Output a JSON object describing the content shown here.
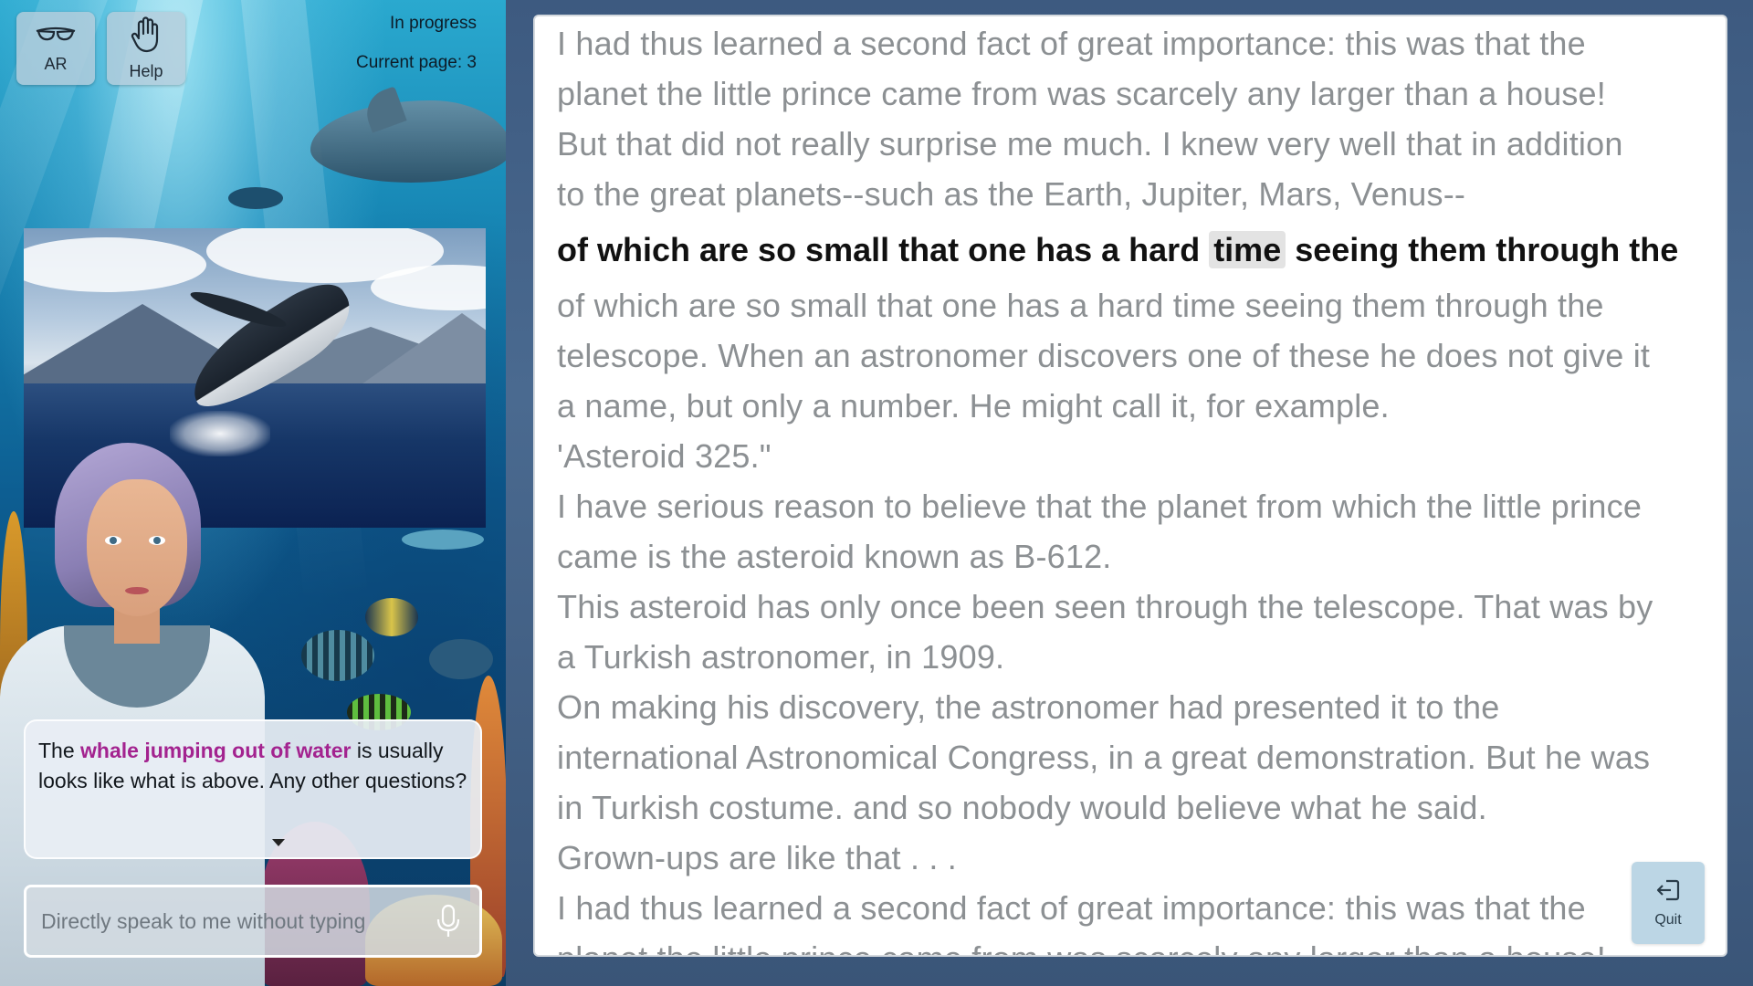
{
  "status": {
    "state": "In progress",
    "current_page": "Current page: 3"
  },
  "toolbar": {
    "ar_label": "AR",
    "help_label": "Help",
    "quit_label": "Quit"
  },
  "chat": {
    "message_prefix": "The ",
    "message_highlight": "whale jumping out of water",
    "message_suffix": " is usually looks like what is above. Any other questions?",
    "highlight_color": "#a3238f"
  },
  "speak_input": {
    "placeholder": "Directly speak to me without typing",
    "value": ""
  },
  "reader": {
    "lines_before": [
      "I had thus learned a second fact of great importance: this was that the",
      "planet the little prince came from was scarcely any larger than a house!",
      "But that did not really surprise me much. I knew very well that in addition",
      "to the great planets--such as the Earth, Jupiter, Mars, Venus--"
    ],
    "current_line_before": "of which are so small that one has a hard ",
    "current_word": "time",
    "current_line_after": " seeing them through the",
    "lines_after": [
      "of which are so small that one has a hard time seeing them through the",
      "telescope. When an astronomer discovers one of these he does not give it",
      "a name, but only a number. He might call it, for example.",
      "'Asteroid 325.\"",
      "I have serious reason to believe that the planet from which the little prince",
      "came is the asteroid known as B-612.",
      "This asteroid has only once been seen through the telescope. That was by",
      "a Turkish astronomer, in 1909.",
      "On making his discovery, the astronomer had presented it to the",
      "international Astronomical Congress, in a great demonstration. But he was",
      "in Turkish costume. and so nobody would believe what he said.",
      "Grown-ups are like that . . .",
      "I had thus learned a second fact of great importance: this was that the",
      "planet the little prince came from was scarcely any larger than a house!"
    ]
  },
  "icons": {
    "ar": "ar-glasses-icon",
    "help": "raised-hand-icon",
    "mic": "microphone-icon",
    "quit": "exit-icon"
  }
}
